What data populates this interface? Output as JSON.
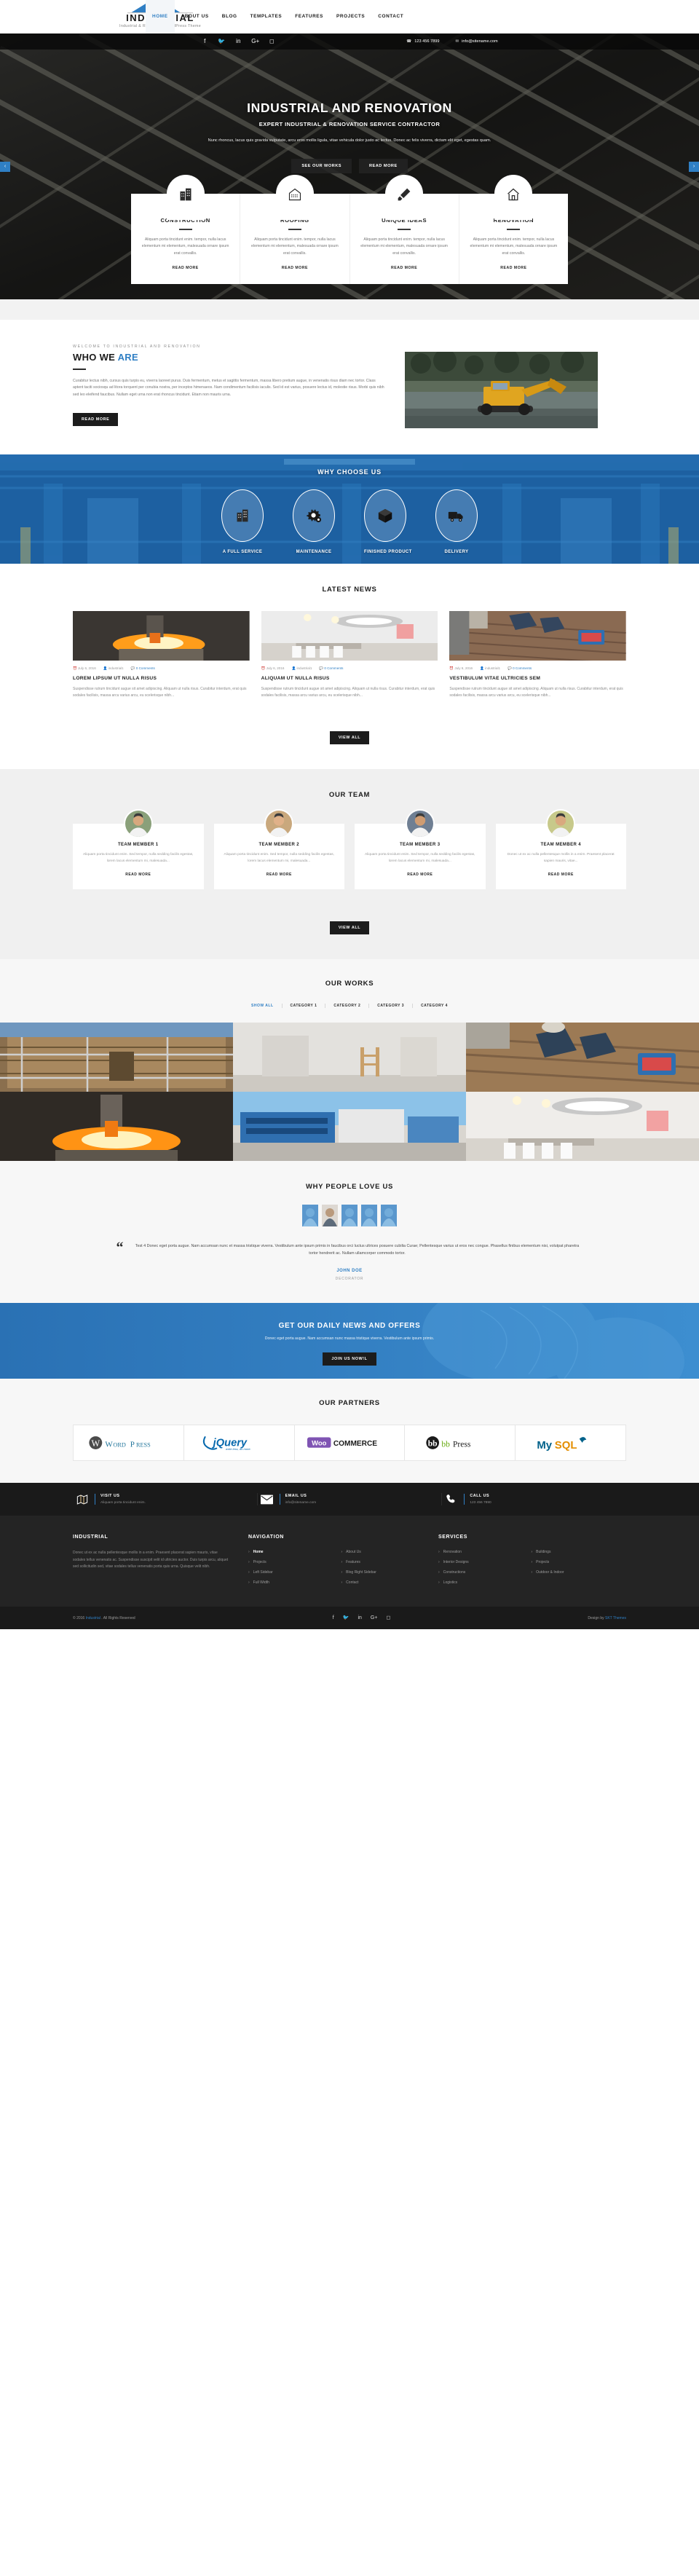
{
  "brand": {
    "name": "INDUSTRIAL",
    "tagline": "Industrial & Renovation WordPress Theme",
    "accent": "#2f7fc4"
  },
  "nav": {
    "items": [
      {
        "label": "HOME",
        "active": true
      },
      {
        "label": "ABOUT US",
        "active": false
      },
      {
        "label": "BLOG",
        "active": false
      },
      {
        "label": "TEMPLATES",
        "active": false
      },
      {
        "label": "FEATURES",
        "active": false
      },
      {
        "label": "PROJECTS",
        "active": false
      },
      {
        "label": "CONTACT",
        "active": false
      }
    ]
  },
  "topbar": {
    "social": [
      "facebook-icon",
      "twitter-icon",
      "linkedin-icon",
      "googleplus-icon",
      "instagram-icon"
    ],
    "phone": "123 456 7899",
    "email": "info@sitename.com"
  },
  "hero": {
    "title": "INDUSTRIAL AND RENOVATION",
    "subtitle": "EXPERT INDUSTRIAL & RENOVATION SERVICE CONTRACTOR",
    "text": "Nunc rhoncus, lacus quis gravida vulputate, arcu eros mollis ligula, vitae vehicula dolor justo ac lectus. Donec ac felis viverra, dictam elit eget, egestas quam.",
    "btn_primary": "SEE OUR WORKS",
    "btn_secondary": "READ MORE",
    "prev": "‹",
    "next": "›"
  },
  "services": {
    "items": [
      {
        "icon": "building-icon",
        "title": "CONSTRUCTION",
        "text": "Aliquam porta tincidunt enim. tempor, nulla lacus elementum mi elementum, malesuada ornare ipsum erat convallis.",
        "more": "READ MORE"
      },
      {
        "icon": "house-icon",
        "title": "ROOFING",
        "text": "Aliquam porta tincidunt enim. tempor, nulla lacus elementum mi elementum, malesuada ornare ipsum erat convallis.",
        "more": "READ MORE"
      },
      {
        "icon": "brush-icon",
        "title": "UNIQUE IDEAS",
        "text": "Aliquam porta tincidunt enim. tempor, nulla lacus elementum mi elementum, malesuada ornare ipsum erat convallis.",
        "more": "READ MORE"
      },
      {
        "icon": "home-icon",
        "title": "RENOVATION",
        "text": "Aliquam porta tincidunt enim. tempor, nulla lacus elementum mi elementum, malesuada ornare ipsum erat convallis.",
        "more": "READ MORE"
      }
    ]
  },
  "who": {
    "eyebrow": "WELCOME TO INDUSTRIAL AND RENOVATION",
    "title_a": "WHO WE ",
    "title_b": "ARE",
    "text": "Curabitur lectus nibh, cursus quis turpis eu, viverra laoreet purus. Duis fermentum, metus et sagittis fermentum, massa libero pretium augue, in venenatis risus diam nec tortor. Class aptent taciti sociosqu ad litora torquent per conubia nostra, per inceptos himenaeos. Nam condimentum facilisis iaculis. Sed id est varius, posuere lectus id, molestie risus. Morbi quis nibh sed leo eleifend faucibus. Nullam eget urna non erat rhoncus tincidunt. Etiam non mauris urna.",
    "button": "READ MORE"
  },
  "why": {
    "title": "WHY CHOOSE US",
    "items": [
      {
        "icon": "building-icon",
        "label": "A FULL SERVICE"
      },
      {
        "icon": "gears-icon",
        "label": "MAINTENANCE"
      },
      {
        "icon": "cube-icon",
        "label": "FINISHED PRODUCT"
      },
      {
        "icon": "truck-icon",
        "label": "DELIVERY"
      }
    ]
  },
  "news": {
    "title": "LATEST NEWS",
    "button": "VIEW ALL",
    "items": [
      {
        "date": "July 6, 2016",
        "author": "industrial1",
        "comments": "0 Comments",
        "title": "LOREM LIPSUM UT NULLA RISUS",
        "excerpt": "Suspendisse rutrum tincidunt augue sit amet adipiscing. Aliquam ut nulla risus. Curabitur interdum, erat quis sodales facilisis, massa arcu varius arcu, eu scelerisque nibh..."
      },
      {
        "date": "July 6, 2016",
        "author": "industrial1",
        "comments": "0 Comments",
        "title": "ALIQUAM UT NULLA RISUS",
        "excerpt": "Suspendisse rutrum tincidunt augue sit amet adipiscing. Aliquam ut nulla risus. Curabitur interdum, erat quis sodales facilisis, massa arcu varius arcu, eu scelerisque nibh..."
      },
      {
        "date": "July 6, 2016",
        "author": "industrial1",
        "comments": "0 Comments",
        "title": "VESTIBULUM VITAE ULTRICIES SEM",
        "excerpt": "Suspendisse rutrum tincidunt augue sit amet adipiscing. Aliquam ut nulla risus. Curabitur interdum, erat quis sodales facilisis, massa arcu varius arcu, eu scelerisque nibh..."
      }
    ]
  },
  "team": {
    "title": "OUR TEAM",
    "button": "VIEW ALL",
    "members": [
      {
        "name": "TEAM MEMBER 1",
        "text": "Aliquam porta tincidunt enim. Sed tempor, nulla sedding facilis egestas, lorem lacus elementum mi, malesuada...",
        "more": "READ MORE"
      },
      {
        "name": "TEAM MEMBER 2",
        "text": "Aliquam porta tincidunt enim. Sed tempor, nulla sedding facilis egestas, lorem lacus elementum mi, malesuada...",
        "more": "READ MORE"
      },
      {
        "name": "TEAM MEMBER 3",
        "text": "Aliquam porta tincidunt enim. Sed tempor, nulla sedding facilis egestas, lorem lacus elementum mi, malesuada...",
        "more": "READ MORE"
      },
      {
        "name": "TEAM MEMBER 4",
        "text": "Donec ut ex ac nulla pellentesque mollis in a enim. Praesent placerat sapien mauris, vitae...",
        "more": "READ MORE"
      }
    ]
  },
  "works": {
    "title": "OUR WORKS",
    "filters": [
      {
        "label": "SHOW ALL",
        "active": true
      },
      {
        "label": "CATEGORY 1",
        "active": false
      },
      {
        "label": "CATEGORY 2",
        "active": false
      },
      {
        "label": "CATEGORY 3",
        "active": false
      },
      {
        "label": "CATEGORY 4",
        "active": false
      }
    ]
  },
  "testimonial": {
    "title": "WHY PEOPLE LOVE US",
    "quote": "Test 4 Donec eget porta augue. Nam accumsan nunc et massa tristique viverra. Vestibulum ante ipsum primis in faucibus orci luctus ultrices posuere cubilia Curae; Pellentesque varius ut eros nec congue. Phasellus finibus elementum nisi, volutpat pharetra tortor hendrerit ac. Nullam ullamcorper commodo tortor.",
    "name": "JOHN DOE",
    "role": "DECORATOR"
  },
  "cta": {
    "title": "GET OUR DAILY NEWS AND OFFERS",
    "text": "Donec eget porta augue. Nam accumsan nunc massa tristique viverra. Vestibulum ante ipsum primis.",
    "button": "JOIN US NOW!L"
  },
  "partners": {
    "title": "OUR PARTNERS",
    "logos": [
      "WordPress",
      "jQuery",
      "WooCommerce",
      "bbPress",
      "MySQL"
    ]
  },
  "footer_contact": [
    {
      "icon": "map-icon",
      "title": "VISIT US",
      "value": "Aliquam porta tincidunt enim."
    },
    {
      "icon": "envelope-icon",
      "title": "EMAIL US",
      "value": "info@sitename.com"
    },
    {
      "icon": "phone-icon",
      "title": "CALL US",
      "value": "123 456 7890"
    }
  ],
  "footer": {
    "about_title": "INDUSTRIAL",
    "about_text": "Donec ut ex ac nulla pellentesque mollis in a enim. Praesent placerat sapien mauris, vitae sodales tellus venenatis ac. Suspendisse suscipit velit id ultricies auctor. Duis turpis arcu, aliquet sed sollicitudin sed, vitae sodales tellus venenatis porta quis urna. Quisque velit nibh.",
    "nav_title": "NAVIGATION",
    "nav_col1": [
      {
        "label": "Home",
        "current": true
      },
      {
        "label": "Projects",
        "current": false
      },
      {
        "label": "Left Sidebar",
        "current": false
      },
      {
        "label": "Full Width",
        "current": false
      }
    ],
    "nav_col2": [
      {
        "label": "About Us",
        "current": false
      },
      {
        "label": "Features",
        "current": false
      },
      {
        "label": "Blog Right Sidebar",
        "current": false
      },
      {
        "label": "Contact",
        "current": false
      }
    ],
    "services_title": "SERVICES",
    "svc_col1": [
      {
        "label": "Renovation"
      },
      {
        "label": "Interior Designs"
      },
      {
        "label": "Constructions"
      },
      {
        "label": "Logistics"
      }
    ],
    "svc_col2": [
      {
        "label": "Buildings"
      },
      {
        "label": "Projects"
      },
      {
        "label": "Outdoor & Indoor"
      }
    ],
    "copyright_pre": "© 2016 ",
    "copyright_link": "Industrial",
    "copyright_post": " . All Rights Reserved",
    "design_pre": "Design by ",
    "design_link": "SKT Themes",
    "social": [
      "facebook-icon",
      "twitter-icon",
      "linkedin-icon",
      "googleplus-icon",
      "instagram-icon"
    ]
  }
}
